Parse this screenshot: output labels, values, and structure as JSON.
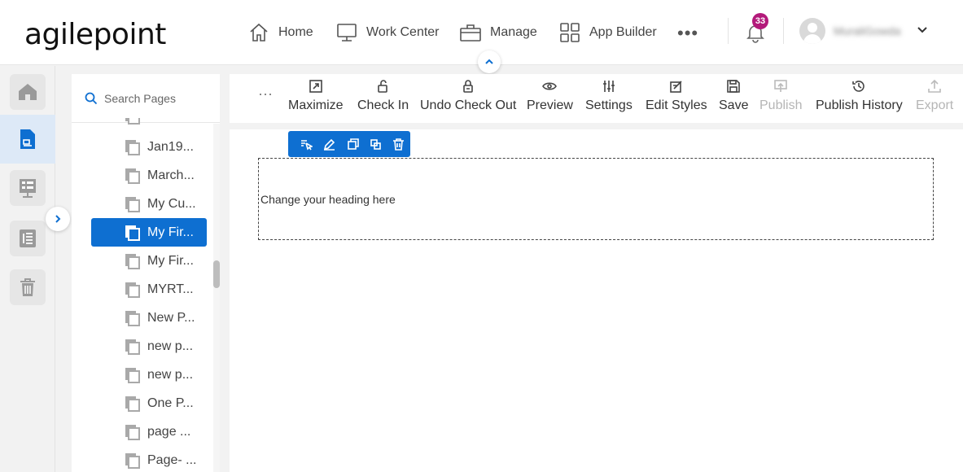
{
  "app": {
    "logo": "agilepoint"
  },
  "nav": {
    "items": [
      {
        "label": "Home",
        "icon": "home-icon"
      },
      {
        "label": "Work Center",
        "icon": "monitor-icon"
      },
      {
        "label": "Manage",
        "icon": "briefcase-icon"
      },
      {
        "label": "App Builder",
        "icon": "grid-icon"
      }
    ],
    "more": "•••",
    "notifications_count": "33",
    "username": "MuraliGowda"
  },
  "search": {
    "placeholder": "Search Pages"
  },
  "pages": [
    {
      "label": "Jan19..."
    },
    {
      "label": "March..."
    },
    {
      "label": "My Cu..."
    },
    {
      "label": "My Fir...",
      "selected": true
    },
    {
      "label": "My Fir..."
    },
    {
      "label": "MYRT..."
    },
    {
      "label": "New P..."
    },
    {
      "label": "new p..."
    },
    {
      "label": "new p..."
    },
    {
      "label": "One P..."
    },
    {
      "label": "page ..."
    },
    {
      "label": "Page- ..."
    }
  ],
  "toolbar": {
    "ellipsis": "···",
    "maximize": "Maximize",
    "check_in": "Check In",
    "undo_check_out": "Undo Check Out",
    "preview": "Preview",
    "settings": "Settings",
    "edit_styles": "Edit Styles",
    "save": "Save",
    "publish": "Publish",
    "publish_history": "Publish History",
    "export": "Export"
  },
  "canvas": {
    "heading": "Change your heading here"
  },
  "colors": {
    "accent": "#0e6fd1",
    "badge": "#b3197a",
    "active_rail_bg": "#dde9f7"
  }
}
